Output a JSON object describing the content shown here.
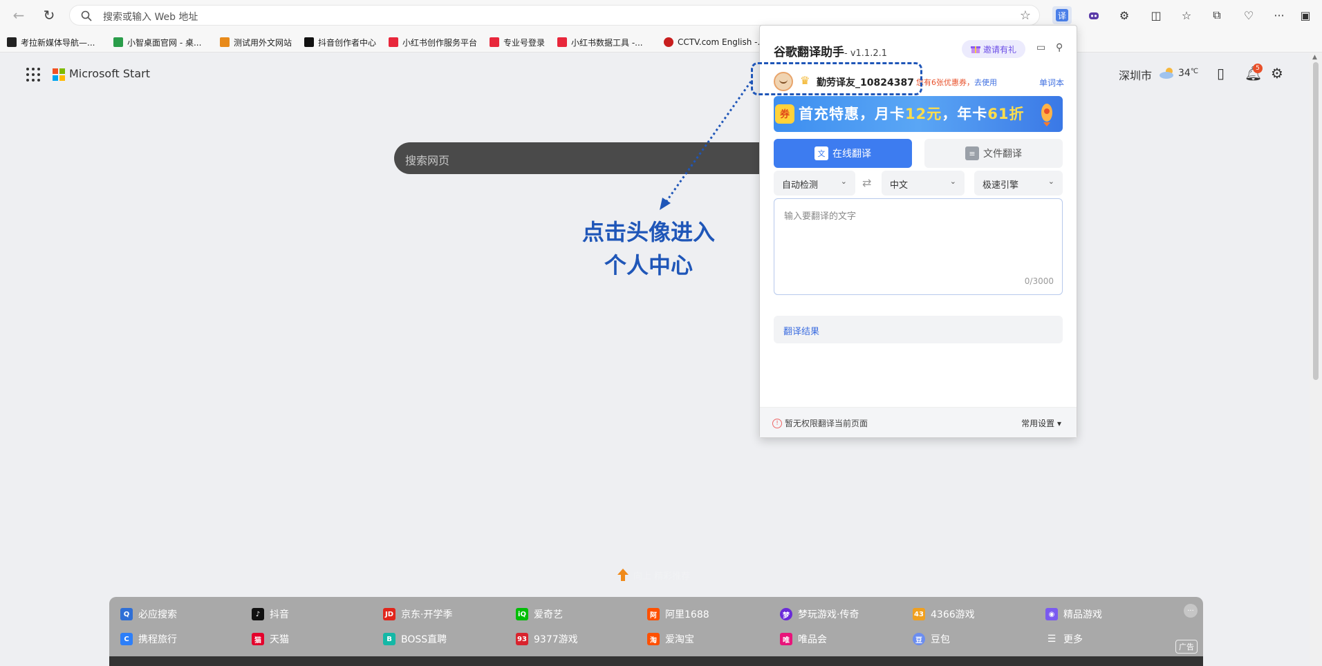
{
  "browser": {
    "address_placeholder": "搜索或输入 Web 地址",
    "extension_label": "译",
    "bookmarks": [
      {
        "label": "考拉新媒体导航—...",
        "color": "#222222"
      },
      {
        "label": "小智桌面官网 - 桌...",
        "color": "#2a9d4a"
      },
      {
        "label": "测试用外文网站",
        "color": "#e88a1a"
      },
      {
        "label": "抖音创作者中心",
        "color": "#111111"
      },
      {
        "label": "小红书创作服务平台",
        "color": "#e8273b"
      },
      {
        "label": "专业号登录",
        "color": "#e8273b"
      },
      {
        "label": "小红书数据工具 -...",
        "color": "#e8273b"
      },
      {
        "label": "CCTV.com English -...",
        "color": "#c81e1e"
      }
    ]
  },
  "page": {
    "brand": "Microsoft Start",
    "city": "深圳市",
    "temperature": "34",
    "temp_unit": "℃",
    "notification_count": "5",
    "search_placeholder": "搜索网页",
    "annotation": [
      "点击头像进入",
      "个人中心"
    ],
    "up_hint": "向上 精彩推荐",
    "quick_links_row1": [
      {
        "label": "必应搜索",
        "icon": "search-icon",
        "color": "#2f6fd6"
      },
      {
        "label": "抖音",
        "icon": "douyin-icon",
        "color": "#111111"
      },
      {
        "label": "京东·开学季",
        "icon": "jd-icon",
        "color": "#e1251b"
      },
      {
        "label": "爱奇艺",
        "icon": "iqiyi-icon",
        "color": "#00be06"
      },
      {
        "label": "阿里1688",
        "icon": "alibaba-icon",
        "color": "#ff5000"
      },
      {
        "label": "梦玩游戏·传奇",
        "icon": "game-icon",
        "color": "#6a2bd9"
      },
      {
        "label": "4366游戏",
        "icon": "4366-icon",
        "color": "#f0a020"
      },
      {
        "label": "精品游戏",
        "icon": "gamepad-icon",
        "color": "#7a5af0"
      }
    ],
    "quick_links_row2": [
      {
        "label": "携程旅行",
        "icon": "ctrip-icon",
        "color": "#2d7ff9"
      },
      {
        "label": "天猫",
        "icon": "tmall-icon",
        "color": "#e4002b"
      },
      {
        "label": "BOSS直聘",
        "icon": "boss-icon",
        "color": "#14b8a6"
      },
      {
        "label": "9377游戏",
        "icon": "9377-icon",
        "color": "#d9232d"
      },
      {
        "label": "爱淘宝",
        "icon": "taobao-icon",
        "color": "#ff5000"
      },
      {
        "label": "唯品会",
        "icon": "vip-icon",
        "color": "#e8147a"
      },
      {
        "label": "豆包",
        "icon": "doubao-icon",
        "color": "#6b8df0"
      },
      {
        "label": "更多",
        "icon": "menu-icon",
        "color": "#666666"
      }
    ],
    "ad_label": "广告"
  },
  "popup": {
    "title": "谷歌翻译助手",
    "version": "- v1.1.2.1",
    "invite_label": "邀请有礼",
    "username": "勤劳译友_10824387",
    "coupon_text": "您有6张优惠券，",
    "coupon_action": "去使用",
    "wordbook_label": "单词本",
    "banner_text_a": "首充特惠，月卡",
    "banner_price_a": "12元",
    "banner_text_b": "，年卡",
    "banner_price_b": "61折",
    "tab_online": "在线翻译",
    "tab_file": "文件翻译",
    "source_lang": "自动检测",
    "target_lang": "中文",
    "engine": "极速引擎",
    "input_placeholder": "输入要翻译的文字",
    "char_count": "0/3000",
    "result_label": "翻译结果",
    "no_permission": "暂无权限翻译当前页面",
    "settings_label": "常用设置 ▾"
  }
}
